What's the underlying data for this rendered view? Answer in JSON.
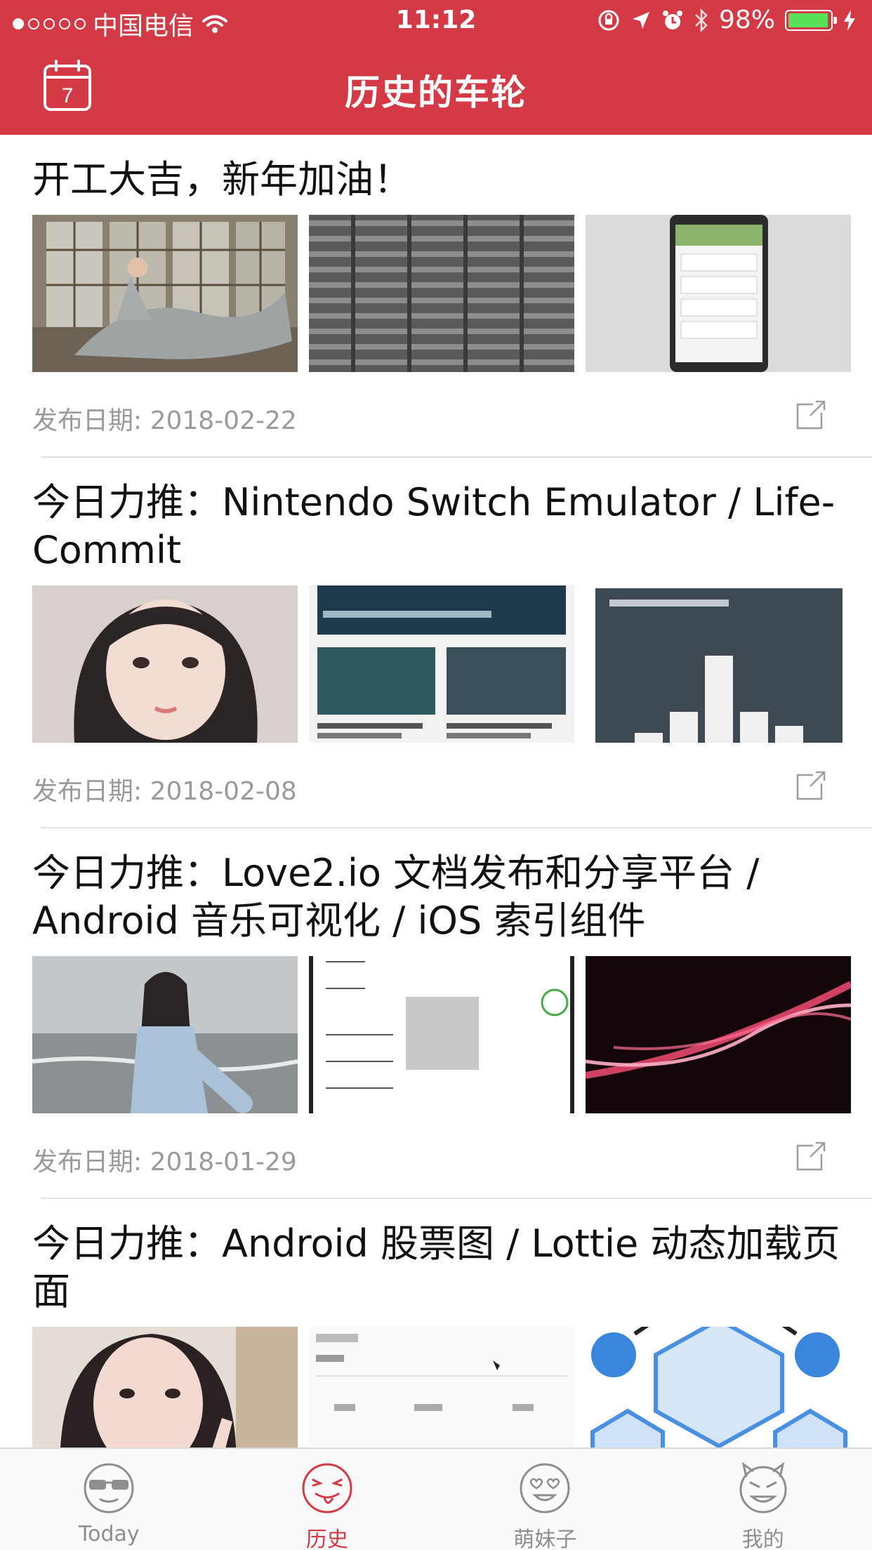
{
  "status_bar": {
    "carrier": "中国电信",
    "time": "11:12",
    "battery": "98%",
    "colors": {
      "battery_fill": "#57e15a"
    }
  },
  "nav": {
    "title": "历史的车轮",
    "calendar_day": "7",
    "colors": {
      "bar": "#d33a45"
    }
  },
  "feed": [
    {
      "title": "开工大吉，新年加油！",
      "date_label": "发布日期: 2018-02-22",
      "thumbs": [
        "photo-girl-window",
        "blurred-pattern",
        "app-screenshot"
      ]
    },
    {
      "title": "今日力推：Nintendo Switch Emulator / Life-Commit",
      "date_label": "发布日期: 2018-02-08",
      "thumbs": [
        "photo-girl-portrait",
        "app-cards-screenshot",
        "when-did-you-start-coding-chart"
      ]
    },
    {
      "title": "今日力推：Love2.io 文档发布和分享平台 / Android 音乐可视化 / iOS 索引组件",
      "date_label": "发布日期: 2018-01-29",
      "thumbs": [
        "photo-girl-beach",
        "index-list-screenshot",
        "pink-light-wave"
      ]
    },
    {
      "title": "今日力推：Android 股票图 / Lottie 动态加载页面",
      "date_label": "",
      "thumbs": [
        "photo-girl-peace-sign",
        "history-screenshot",
        "blue-hexagon-graphic"
      ]
    }
  ],
  "tabs": [
    {
      "label": "Today",
      "icon": "sunglasses-face-icon",
      "active": false
    },
    {
      "label": "历史",
      "icon": "tongue-face-icon",
      "active": true
    },
    {
      "label": "萌妹子",
      "icon": "heart-eyes-face-icon",
      "active": false
    },
    {
      "label": "我的",
      "icon": "devil-face-icon",
      "active": false
    }
  ],
  "accent_color": "#d33a45"
}
